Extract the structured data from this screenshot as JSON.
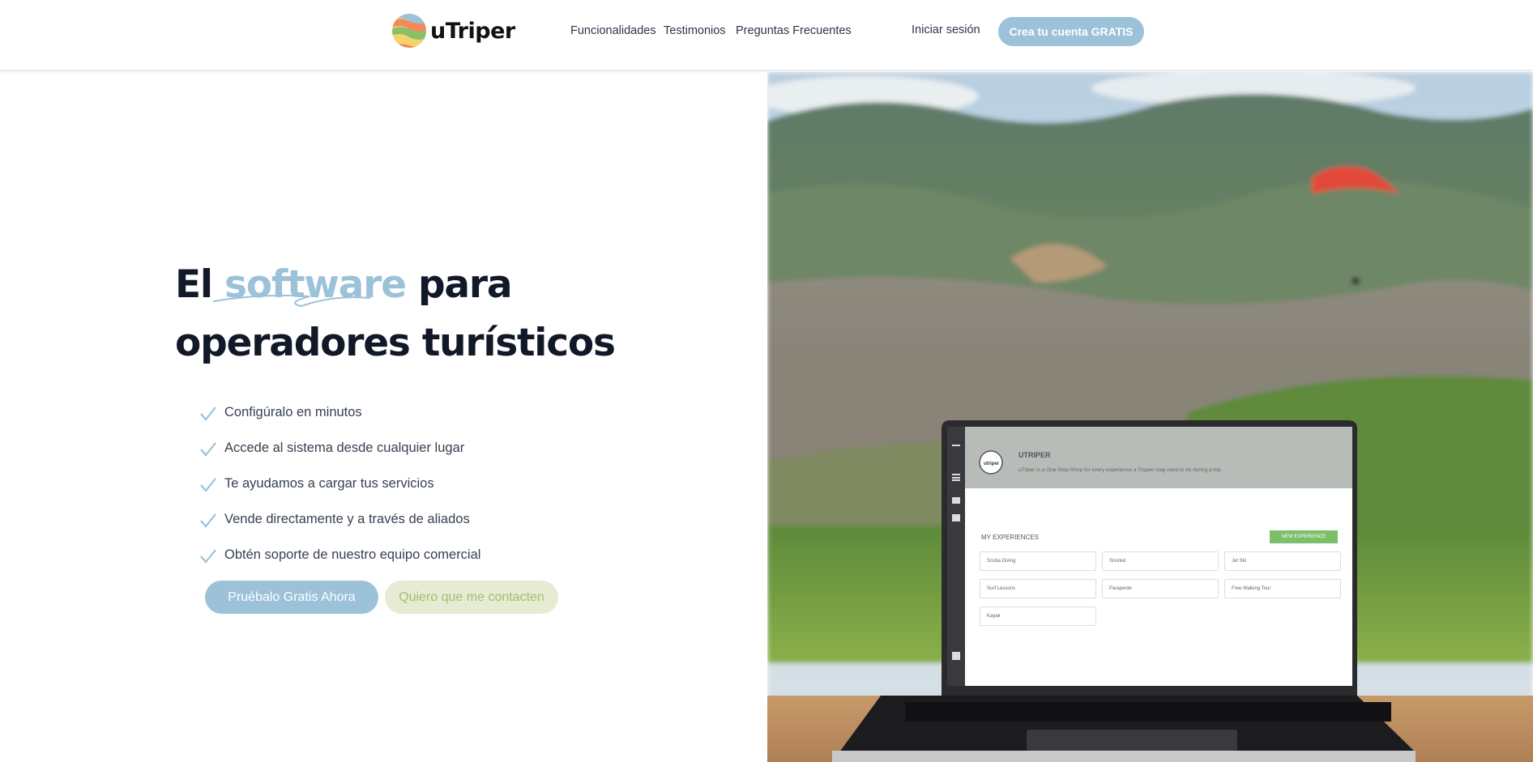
{
  "header": {
    "brand": "uTriper",
    "nav": [
      "Funcionalidades",
      "Testimonios",
      "Preguntas Frecuentes"
    ],
    "login": "Iniciar sesión",
    "cta": "Crea tu cuenta GRATIS"
  },
  "hero": {
    "title_prefix": "El",
    "title_highlight": "software",
    "title_suffix": "para",
    "title_line2": "operadores turísticos",
    "features": [
      "Configúralo en minutos",
      "Accede al sistema desde cualquier lugar",
      "Te ayudamos a cargar tus servicios",
      "Vende directamente y a través de aliados",
      "Obtén soporte de nuestro equipo comercial"
    ],
    "primary_button": "Pruébalo Gratis Ahora",
    "secondary_button": "Quiero que me contacten"
  },
  "laptop_screen": {
    "company": "UTRIPER",
    "tagline": "uTriper is a One-Stop-Shop for every experience a Tripper may want to do during a trip.",
    "section_title": "MY EXPERIENCES",
    "new_button": "NEW EXPERIENCE",
    "experiences": [
      "Scuba Diving",
      "Snorkel",
      "Jet Ski",
      "Surf Lessons",
      "Parapente",
      "Free Walking Tour",
      "Kayak"
    ]
  },
  "colors": {
    "accent": "#9cc2d9",
    "secondary_bg": "#e5ecd3",
    "secondary_text": "#a9bb6e",
    "title": "#111827"
  }
}
